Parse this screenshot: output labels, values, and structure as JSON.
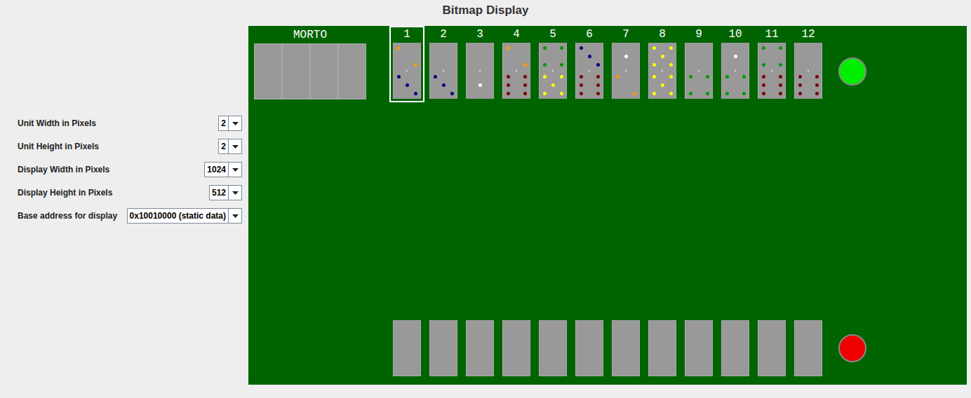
{
  "window": {
    "title": "Bitmap Display"
  },
  "settings": [
    {
      "label": "Unit Width in Pixels",
      "value": "2"
    },
    {
      "label": "Unit Height in Pixels",
      "value": "2"
    },
    {
      "label": "Display Width in Pixels",
      "value": "1024"
    },
    {
      "label": "Display Height in Pixels",
      "value": "512"
    },
    {
      "label": "Base address for display",
      "value": "0x10010000 (static data)"
    }
  ],
  "board": {
    "discard": {
      "label": "MORTO",
      "tiles": 4
    },
    "table": [
      {
        "label": "1",
        "selected": true,
        "top": {
          "pips": 2,
          "color": "#ff9900"
        },
        "bottom": {
          "pips": 3,
          "color": "#000080"
        }
      },
      {
        "label": "2",
        "selected": false,
        "top": {
          "pips": 0,
          "color": "#000000"
        },
        "bottom": {
          "pips": 3,
          "color": "#000080"
        }
      },
      {
        "label": "3",
        "selected": false,
        "top": {
          "pips": 0,
          "color": "#000000"
        },
        "bottom": {
          "pips": 1,
          "color": "#ffffff"
        }
      },
      {
        "label": "4",
        "selected": false,
        "top": {
          "pips": 2,
          "color": "#ff9900"
        },
        "bottom": {
          "pips": 6,
          "color": "#800000"
        }
      },
      {
        "label": "5",
        "selected": false,
        "top": {
          "pips": 4,
          "color": "#009900"
        },
        "bottom": {
          "pips": 5,
          "color": "#ffff00"
        }
      },
      {
        "label": "6",
        "selected": false,
        "top": {
          "pips": 3,
          "color": "#000080"
        },
        "bottom": {
          "pips": 6,
          "color": "#800000"
        }
      },
      {
        "label": "7",
        "selected": false,
        "top": {
          "pips": 1,
          "color": "#ffffff"
        },
        "bottom": {
          "pips": 2,
          "color": "#ff9900"
        }
      },
      {
        "label": "8",
        "selected": false,
        "top": {
          "pips": 5,
          "color": "#ffff00"
        },
        "bottom": {
          "pips": 5,
          "color": "#ffff00"
        }
      },
      {
        "label": "9",
        "selected": false,
        "top": {
          "pips": 0,
          "color": "#000000"
        },
        "bottom": {
          "pips": 4,
          "color": "#009900"
        }
      },
      {
        "label": "10",
        "selected": false,
        "top": {
          "pips": 1,
          "color": "#ffffff"
        },
        "bottom": {
          "pips": 4,
          "color": "#009900"
        }
      },
      {
        "label": "11",
        "selected": false,
        "top": {
          "pips": 4,
          "color": "#009900"
        },
        "bottom": {
          "pips": 6,
          "color": "#800000"
        }
      },
      {
        "label": "12",
        "selected": false,
        "top": {
          "pips": 0,
          "color": "#000000"
        },
        "bottom": {
          "pips": 6,
          "color": "#800000"
        }
      }
    ],
    "top_indicator": {
      "color": "#00ee00"
    },
    "player": {
      "tiles": 12,
      "indicator_color": "#ee0000"
    }
  }
}
